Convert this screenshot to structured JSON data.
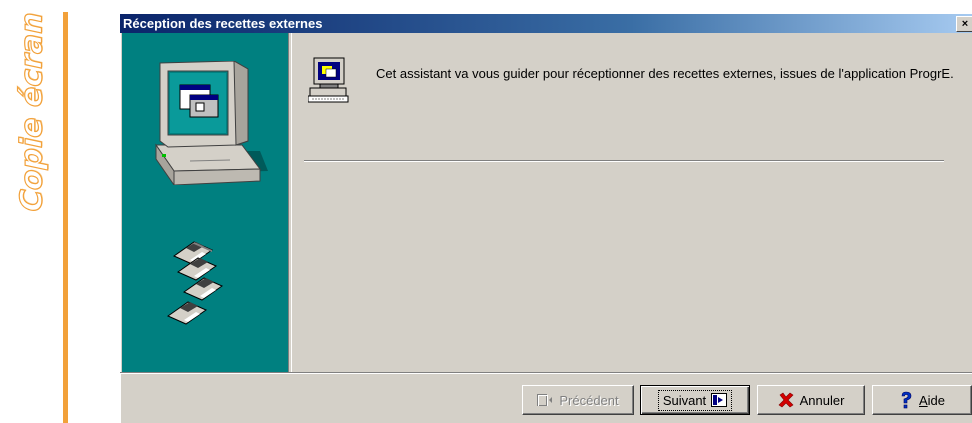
{
  "sidebar_caption": "Copie écran",
  "window": {
    "title": "Réception des recettes externes",
    "close_label": "×"
  },
  "content": {
    "intro_text": "Cet assistant va vous guider pour réceptionner des recettes externes, issues de l'application ProgrE."
  },
  "buttons": {
    "previous": "Précédent",
    "next": "Suivant",
    "cancel": "Annuler",
    "help_prefix": "",
    "help_accel": "A",
    "help_rest": "ide"
  },
  "icons": {
    "side_top": "computer-icon",
    "side_bottom": "floppy-disks-icon",
    "wizard": "wizard-computer-icon",
    "previous": "previous-arrow-icon",
    "next": "next-arrow-icon",
    "cancel": "red-x-icon",
    "help": "question-mark-icon"
  },
  "colors": {
    "title_bar_start": "#0a246a",
    "title_bar_end": "#a6caf0",
    "side_panel": "#008080",
    "dialog_face": "#d4d0c8",
    "accent_rule": "#f2a13a"
  }
}
